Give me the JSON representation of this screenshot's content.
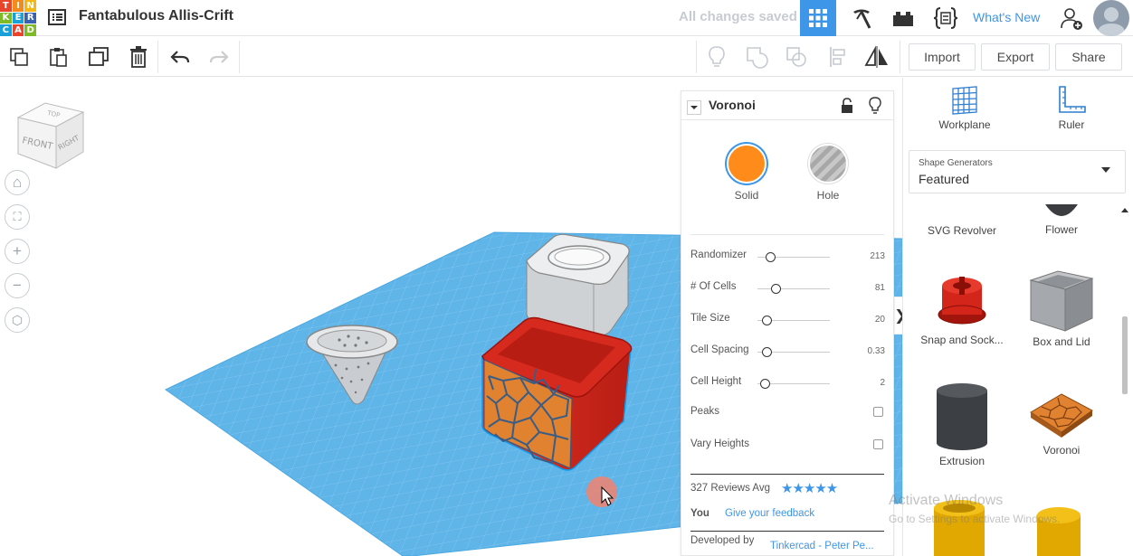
{
  "app": {
    "logo_letters": [
      "T",
      "I",
      "N",
      "K",
      "E",
      "R",
      "C",
      "A",
      "D"
    ],
    "project_title": "Fantabulous Allis-Crift",
    "save_status": "All changes saved",
    "whats_new": "What's New"
  },
  "toolbar": {
    "import_label": "Import",
    "export_label": "Export",
    "share_label": "Share"
  },
  "viewcube": {
    "top": "TOP",
    "front": "FRONT",
    "right": "RIGHT"
  },
  "inspector": {
    "shape_name": "Voronoi",
    "solid_label": "Solid",
    "hole_label": "Hole",
    "solid_color": "#ff8c1a",
    "params": [
      {
        "label": "Randomizer",
        "value": "213",
        "pos": 0.18
      },
      {
        "label": "# Of Cells",
        "value": "81",
        "pos": 0.25
      },
      {
        "label": "Tile Size",
        "value": "20",
        "pos": 0.12
      },
      {
        "label": "Cell Spacing",
        "value": "0.33",
        "pos": 0.12
      },
      {
        "label": "Cell Height",
        "value": "2",
        "pos": 0.1
      }
    ],
    "checks": [
      {
        "label": "Peaks"
      },
      {
        "label": "Vary Heights"
      }
    ],
    "reviews_label": "327 Reviews Avg",
    "you_label": "You",
    "feedback_link": "Give your feedback",
    "developed_label": "Developed by",
    "developer": "Tinkercad - Peter Pe..."
  },
  "rightpanel": {
    "workplane_label": "Workplane",
    "ruler_label": "Ruler",
    "dropdown_label": "Shape Generators",
    "dropdown_value": "Featured",
    "generators": [
      {
        "label": "SVG Revolver"
      },
      {
        "label": "Flower"
      },
      {
        "label": "Snap and Sock..."
      },
      {
        "label": "Box and Lid"
      },
      {
        "label": "Extrusion"
      },
      {
        "label": "Voronoi"
      }
    ]
  },
  "watermark": {
    "line1": "Activate Windows",
    "line2": "Go to Settings to activate Windows."
  },
  "colors": {
    "accent": "#3d96e8",
    "workplane": "#5fb4e8",
    "red_box": "#d92a1f"
  }
}
